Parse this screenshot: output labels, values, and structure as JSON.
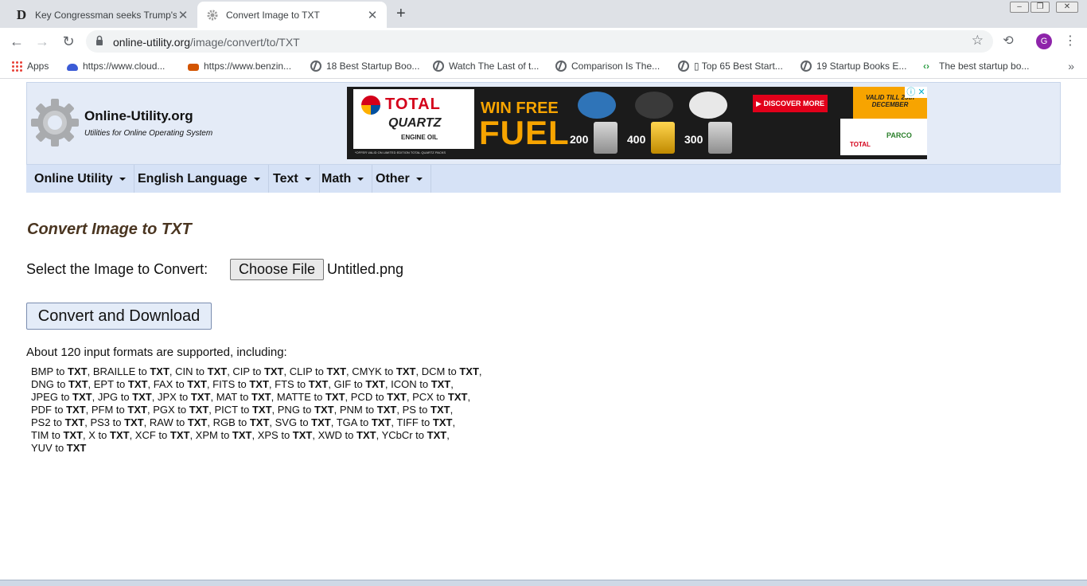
{
  "browser": {
    "tabs": [
      {
        "title": "Key Congressman seeks Trump's",
        "favicon": "D",
        "active": false
      },
      {
        "title": "Convert Image to TXT",
        "favicon": "gear",
        "active": true
      }
    ],
    "new_tab": "+",
    "url_host": "online-utility.org",
    "url_path": "/image/convert/to/TXT",
    "profile_initial": "G",
    "bookmarks": [
      {
        "label": "Apps",
        "icon": "apps-grid-icon"
      },
      {
        "label": "https://www.cloud...",
        "icon": "cloud-icon"
      },
      {
        "label": "https://www.benzin...",
        "icon": "car-icon"
      },
      {
        "label": "18 Best Startup Boo...",
        "icon": "globe-icon"
      },
      {
        "label": "Watch The Last of t...",
        "icon": "globe-icon"
      },
      {
        "label": "Comparison Is The...",
        "icon": "globe-icon"
      },
      {
        "label": "▯ Top 65 Best Start...",
        "icon": "globe-icon"
      },
      {
        "label": "19 Startup Books E...",
        "icon": "globe-icon"
      },
      {
        "label": "The best startup bo...",
        "icon": "code-icon"
      }
    ],
    "more_bookmarks": "»"
  },
  "site": {
    "name": "Online-Utility.org",
    "tagline": "Utilities for Online Operating System",
    "nav": [
      "Online Utility",
      "English Language",
      "Text",
      "Math",
      "Other"
    ]
  },
  "ad": {
    "brand": "TOTAL",
    "product": "QUARTZ",
    "product_sub": "ENGINE OIL",
    "headline_top": "WIN FREE",
    "headline": "FUEL",
    "fuel_values": [
      "200",
      "400",
      "300"
    ],
    "cta": "▶ DISCOVER MORE",
    "valid": "VALID TILL 25th DECEMBER",
    "partner1": "TOTAL",
    "partner2": "PARCO",
    "fine_print": "*OFFER VALID ON LIMITED EDITION TOTAL QUARTZ PACKS",
    "close": "ⓘ ✕"
  },
  "main": {
    "heading": "Convert Image to TXT",
    "select_label": "Select the Image to Convert:",
    "choose_file": "Choose File",
    "file_name": "Untitled.png",
    "convert_button": "Convert and Download",
    "formats_intro": "About 120 input formats are supported, including:",
    "target": "TXT",
    "format_lines": [
      [
        "BMP",
        "BRAILLE",
        "CIN",
        "CIP",
        "CLIP",
        "CMYK",
        "DCM"
      ],
      [
        "DNG",
        "EPT",
        "FAX",
        "FITS",
        "FTS",
        "GIF",
        "ICON"
      ],
      [
        "JPEG",
        "JPG",
        "JPX",
        "MAT",
        "MATTE",
        "PCD",
        "PCX"
      ],
      [
        "PDF",
        "PFM",
        "PGX",
        "PICT",
        "PNG",
        "PNM",
        "PS"
      ],
      [
        "PS2",
        "PS3",
        "RAW",
        "RGB",
        "SVG",
        "TGA",
        "TIFF"
      ],
      [
        "TIM",
        "X",
        "XCF",
        "XPM",
        "XPS",
        "XWD",
        "YCbCr"
      ],
      [
        "YUV"
      ]
    ]
  }
}
